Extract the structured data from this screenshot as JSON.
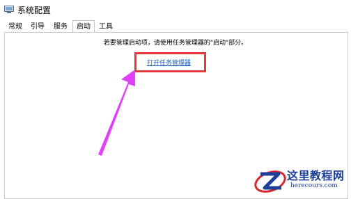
{
  "window": {
    "title": "系统配置"
  },
  "tabs": [
    {
      "label": "常规"
    },
    {
      "label": "引导"
    },
    {
      "label": "服务"
    },
    {
      "label": "启动",
      "active": true
    },
    {
      "label": "工具"
    }
  ],
  "startup": {
    "message": "若要管理启动项，请使用任务管理器的\"启动\"部分。",
    "link_label": "打开任务管理器"
  },
  "annotation": {
    "box_color": "#e5383b",
    "arrow_color": "#e040fb"
  },
  "watermark": {
    "line1": "这里教程网",
    "line2": "herecours.com"
  }
}
